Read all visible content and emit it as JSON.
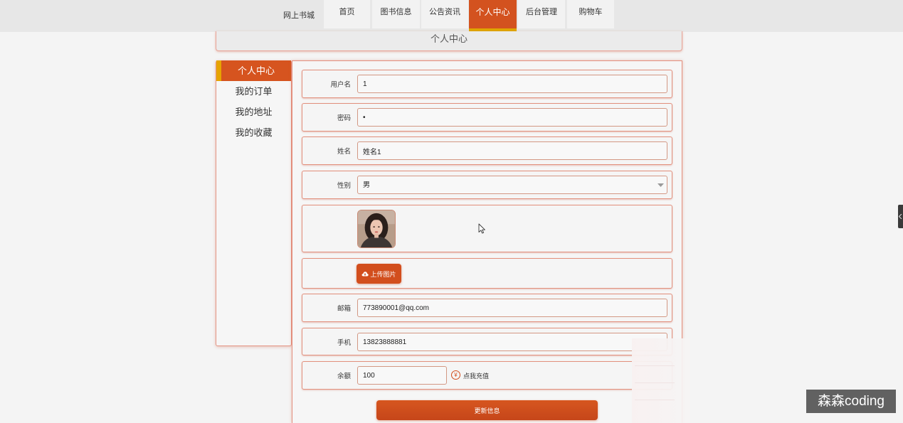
{
  "nav": {
    "brand": "网上书城",
    "items": [
      {
        "label": "首页",
        "active": false
      },
      {
        "label": "图书信息",
        "active": false
      },
      {
        "label": "公告资讯",
        "active": false
      },
      {
        "label": "个人中心",
        "active": true
      },
      {
        "label": "后台管理",
        "active": false
      },
      {
        "label": "购物车",
        "active": false
      }
    ]
  },
  "page_header": {
    "title": "个人中心"
  },
  "sidebar": {
    "items": [
      {
        "label": "个人中心",
        "active": true
      },
      {
        "label": "我的订单",
        "active": false
      },
      {
        "label": "我的地址",
        "active": false
      },
      {
        "label": "我的收藏",
        "active": false
      }
    ]
  },
  "form": {
    "username": {
      "label": "用户名",
      "value": "1"
    },
    "password": {
      "label": "密码",
      "value": "•"
    },
    "name": {
      "label": "姓名",
      "value": "姓名1"
    },
    "gender": {
      "label": "性别",
      "value": "男",
      "icon": "chevron-down-icon"
    },
    "avatar": {
      "icon": "avatar-photo"
    },
    "upload": {
      "label": "上传图片",
      "icon": "cloud-upload-icon"
    },
    "email": {
      "label": "邮箱",
      "value": "773890001@qq.com"
    },
    "phone": {
      "label": "手机",
      "value": "13823888881"
    },
    "balance": {
      "label": "余额",
      "value": "100"
    },
    "recharge": {
      "symbol": "¥",
      "label": "点我充值"
    },
    "submit": {
      "label": "更新信息"
    }
  },
  "watermark": {
    "text": "森森coding"
  },
  "colors": {
    "accent": "#d3521f",
    "active_highlight": "#dfa600",
    "border": "#e2907d",
    "background": "#f4f4f4",
    "nav_background": "#e7e7e7"
  }
}
